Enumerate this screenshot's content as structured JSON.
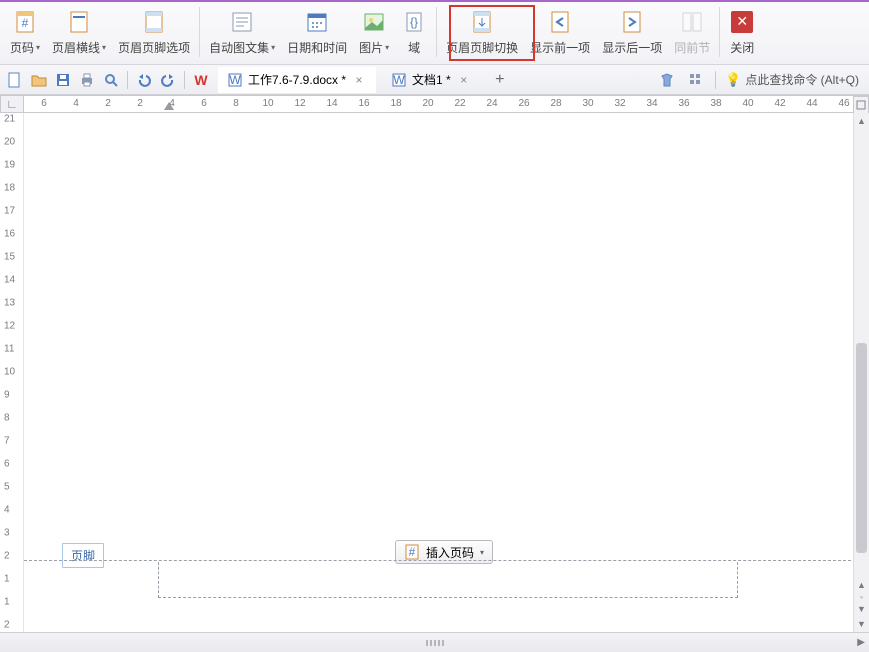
{
  "ribbon": {
    "page_number": "页码",
    "header_hline": "页眉横线",
    "header_footer_options": "页眉页脚选项",
    "auto_text": "自动图文集",
    "date_time": "日期和时间",
    "picture": "图片",
    "field": "域",
    "hf_switch": "页眉页脚切换",
    "show_prev": "显示前一项",
    "show_next": "显示后一项",
    "same_prev": "同前节",
    "close": "关闭"
  },
  "tabs": {
    "doc1": "工作7.6-7.9.docx *",
    "doc2": "文档1 *"
  },
  "qat": {
    "find_cmd_label": "点此查找命令 (Alt+Q)"
  },
  "h_ruler_values": [
    "6",
    "4",
    "2",
    "2",
    "4",
    "6",
    "8",
    "10",
    "12",
    "14",
    "16",
    "18",
    "20",
    "22",
    "24",
    "26",
    "28",
    "30",
    "32",
    "34",
    "36",
    "38",
    "40",
    "42",
    "44",
    "46"
  ],
  "v_ruler_values": [
    "21",
    "20",
    "19",
    "18",
    "17",
    "16",
    "15",
    "14",
    "13",
    "12",
    "11",
    "10",
    "9",
    "8",
    "7",
    "6",
    "5",
    "4",
    "3",
    "2",
    "1",
    "1",
    "2"
  ],
  "footer": {
    "tag": "页脚",
    "insert_page_number": "插入页码"
  },
  "ruler_corner": "∟"
}
